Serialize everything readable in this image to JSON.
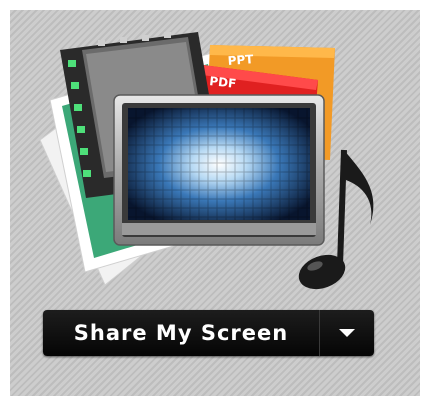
{
  "share": {
    "label": "Share My Screen",
    "doc_labels": {
      "ppt": "PPT",
      "pdf": "PDF"
    }
  },
  "icons": [
    "film-strip-icon",
    "ppt-document-icon",
    "pdf-document-icon",
    "monitor-icon",
    "music-note-icon",
    "chevron-down-icon"
  ],
  "colors": {
    "button_bg": "#0a0a0a",
    "button_text": "#ffffff",
    "panel_bg": "#c9c9c9",
    "ppt_orange": "#f29a26",
    "pdf_red": "#e02020",
    "photo_green": "#3ca878"
  }
}
